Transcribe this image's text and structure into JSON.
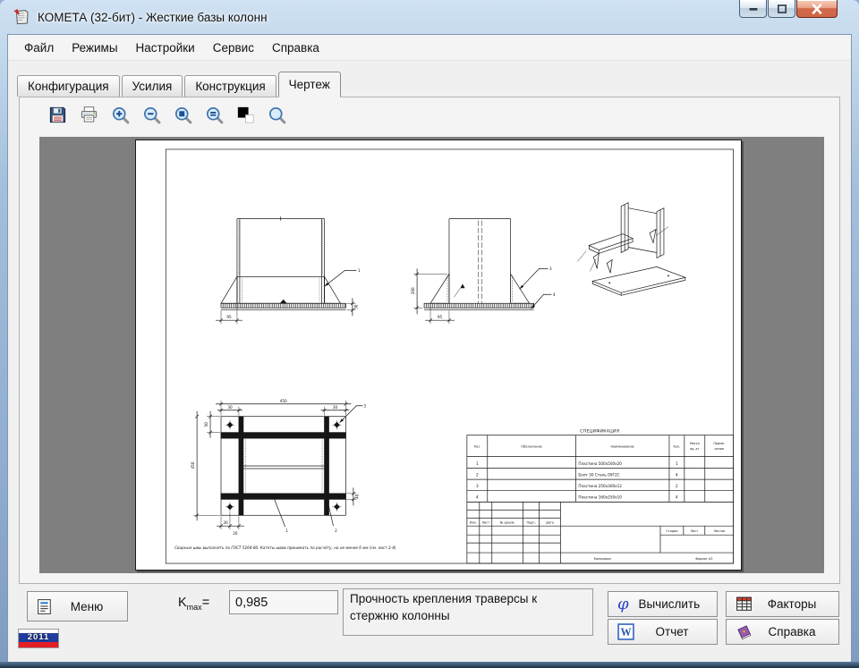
{
  "window": {
    "title": "КОМЕТА (32-бит) - Жесткие базы колонн"
  },
  "menu": {
    "items": [
      "Файл",
      "Режимы",
      "Настройки",
      "Сервис",
      "Справка"
    ]
  },
  "tabs": {
    "items": [
      "Конфигурация",
      "Усилия",
      "Конструкция",
      "Чертеж"
    ],
    "active": "Чертеж"
  },
  "toolbar": {
    "icons": [
      "save",
      "print",
      "zoom-in",
      "zoom-out",
      "zoom-fit",
      "zoom-actual",
      "page-color",
      "zoom-window"
    ]
  },
  "drawing": {
    "spec": {
      "title": "СПЕЦИФИКАЦИЯ",
      "h_pos": "Поз.",
      "h_des": "Обозначение",
      "h_name": "Наименование",
      "h_qty": "Кол.",
      "h_m1": "Масса",
      "h_m2": "ед.,кг",
      "h_n1": "Приме-",
      "h_n2": "чание",
      "rows": [
        {
          "pos": "1",
          "name": "Пластина 500х500х20",
          "qty": "1"
        },
        {
          "pos": "2",
          "name": "Болт 30 Сталь 09Г2С",
          "qty": "4"
        },
        {
          "pos": "3",
          "name": "Пластина 250х300х12",
          "qty": "2"
        },
        {
          "pos": "4",
          "name": "Пластина 160х250х10",
          "qty": "4"
        }
      ]
    },
    "tb": {
      "izm": "Изм.",
      "list": "Лист",
      "doc": "№ докум.",
      "podp": "Подп.",
      "data": "Дата",
      "stage": "Стадия",
      "sheet": "Лист",
      "sheets": "Листов",
      "kopiroval": "Копировал",
      "format": "Формат А3"
    },
    "note": "Сварные швы выполнять по ГОСТ 5264-80. Катеты швов принимать по расчёту, но не менее 6 мм (см. лист 2-4)",
    "dims": {
      "front_a": "95",
      "front_t": "30",
      "side_h": "200",
      "side_a": "95",
      "plan_w": "450",
      "plan_tl": "30",
      "plan_tr": "30",
      "plan_l1": "50",
      "plan_l": "450",
      "plan_t": "40",
      "plan_b1": "30",
      "plan_b2": "20"
    },
    "callouts": {
      "front": "1",
      "side_a": "3",
      "side_b": "4",
      "plan_1": "1",
      "plan_2": "2",
      "plan_3": "3"
    }
  },
  "bottom": {
    "menu_label": "Меню",
    "kmax_base": "K",
    "kmax_sub": "max",
    "kmax_eq": "=",
    "kmax_value": "0,985",
    "status_text": "Прочность крепления траверсы к стержню колонны",
    "actions": [
      {
        "label": "Вычислить",
        "icon": "phi"
      },
      {
        "label": "Факторы",
        "icon": "table-grid"
      },
      {
        "label": "Отчет",
        "icon": "word-report"
      },
      {
        "label": "Справка",
        "icon": "help-book"
      }
    ],
    "phi_glyph": "φ",
    "word_glyph": "W",
    "year_badge": "2011"
  }
}
